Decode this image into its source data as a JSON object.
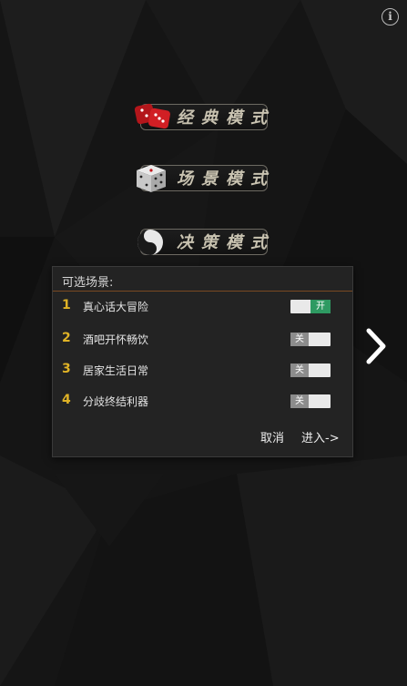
{
  "menu": {
    "classic_label": "经典模式",
    "scene_label": "场景模式",
    "decision_label": "决策模式"
  },
  "icons": {
    "info": "info-icon",
    "classic": "red-dice-icon",
    "scene": "white-dice-icon",
    "decision": "yin-yang-icon",
    "next": "chevron-right-icon"
  },
  "info_glyph": "i",
  "dialog": {
    "title": "可选场景:",
    "scenes": [
      {
        "index": "1",
        "name": "真心话大冒险",
        "toggle_text": "开",
        "enabled": true
      },
      {
        "index": "2",
        "name": "酒吧开怀畅饮",
        "toggle_text": "关",
        "enabled": false
      },
      {
        "index": "3",
        "name": "居家生活日常",
        "toggle_text": "关",
        "enabled": false
      },
      {
        "index": "4",
        "name": "分歧终结利器",
        "toggle_text": "关",
        "enabled": false
      }
    ],
    "cancel_label": "取消",
    "enter_label": "进入->"
  },
  "colors": {
    "background": "#141414",
    "accent_number": "#e0b326",
    "toggle_on": "#2e9a62",
    "toggle_off": "#8c8c8c",
    "divider": "#7a4a22"
  }
}
